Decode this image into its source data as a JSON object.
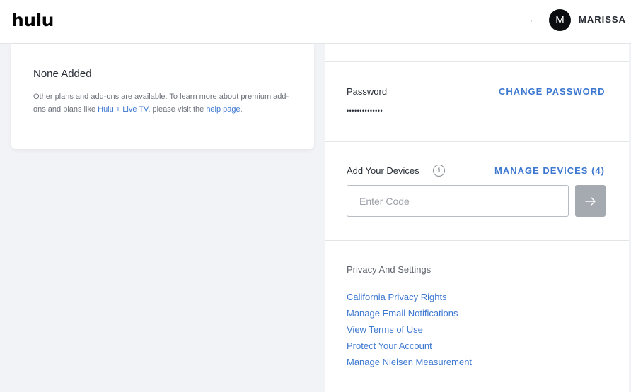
{
  "header": {
    "logo": "hulu",
    "avatar_initial": "M",
    "username": "MARISSA"
  },
  "addons": {
    "title": "None Added",
    "desc_part1": "Other plans and add-ons are available. To learn more about premium add-ons and plans like ",
    "hulu_live_link": "Hulu + Live TV",
    "desc_part2": ", please visit the ",
    "help_link": "help page",
    "desc_end": "."
  },
  "password": {
    "label": "Password",
    "masked_value": "••••••••••••••",
    "change_link": "CHANGE PASSWORD"
  },
  "devices": {
    "label": "Add Your Devices",
    "info_icon": "i",
    "manage_link": "MANAGE DEVICES (4)",
    "code_placeholder": "Enter Code",
    "submit_icon": "arrow-right-icon"
  },
  "privacy": {
    "title": "Privacy And Settings",
    "links": [
      "California Privacy Rights",
      "Manage Email Notifications",
      "View Terms of Use",
      "Protect Your Account",
      "Manage Nielsen Measurement"
    ]
  },
  "colors": {
    "link": "#3d78d0",
    "background": "#f2f3f6",
    "button_disabled": "#a5a9b0"
  }
}
